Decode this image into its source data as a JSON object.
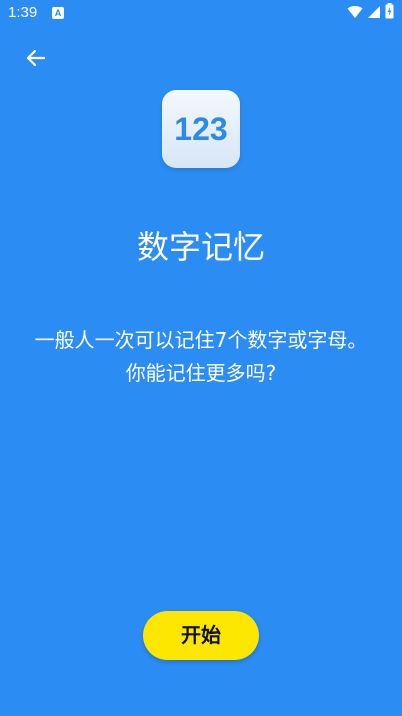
{
  "status_bar": {
    "time": "1:39",
    "app_icon_letter": "A",
    "icons": [
      "wifi-icon",
      "signal-icon",
      "battery-charging-icon"
    ]
  },
  "header": {
    "back_icon": "arrow-left-icon"
  },
  "game": {
    "icon_text": "123",
    "title": "数字记忆",
    "description": "一般人一次可以记住7个数字或字母。你能记住更多吗?",
    "start_label": "开始"
  },
  "colors": {
    "background": "#2b8cf3",
    "start_button": "#fde600",
    "icon_number": "#2e8be5"
  }
}
